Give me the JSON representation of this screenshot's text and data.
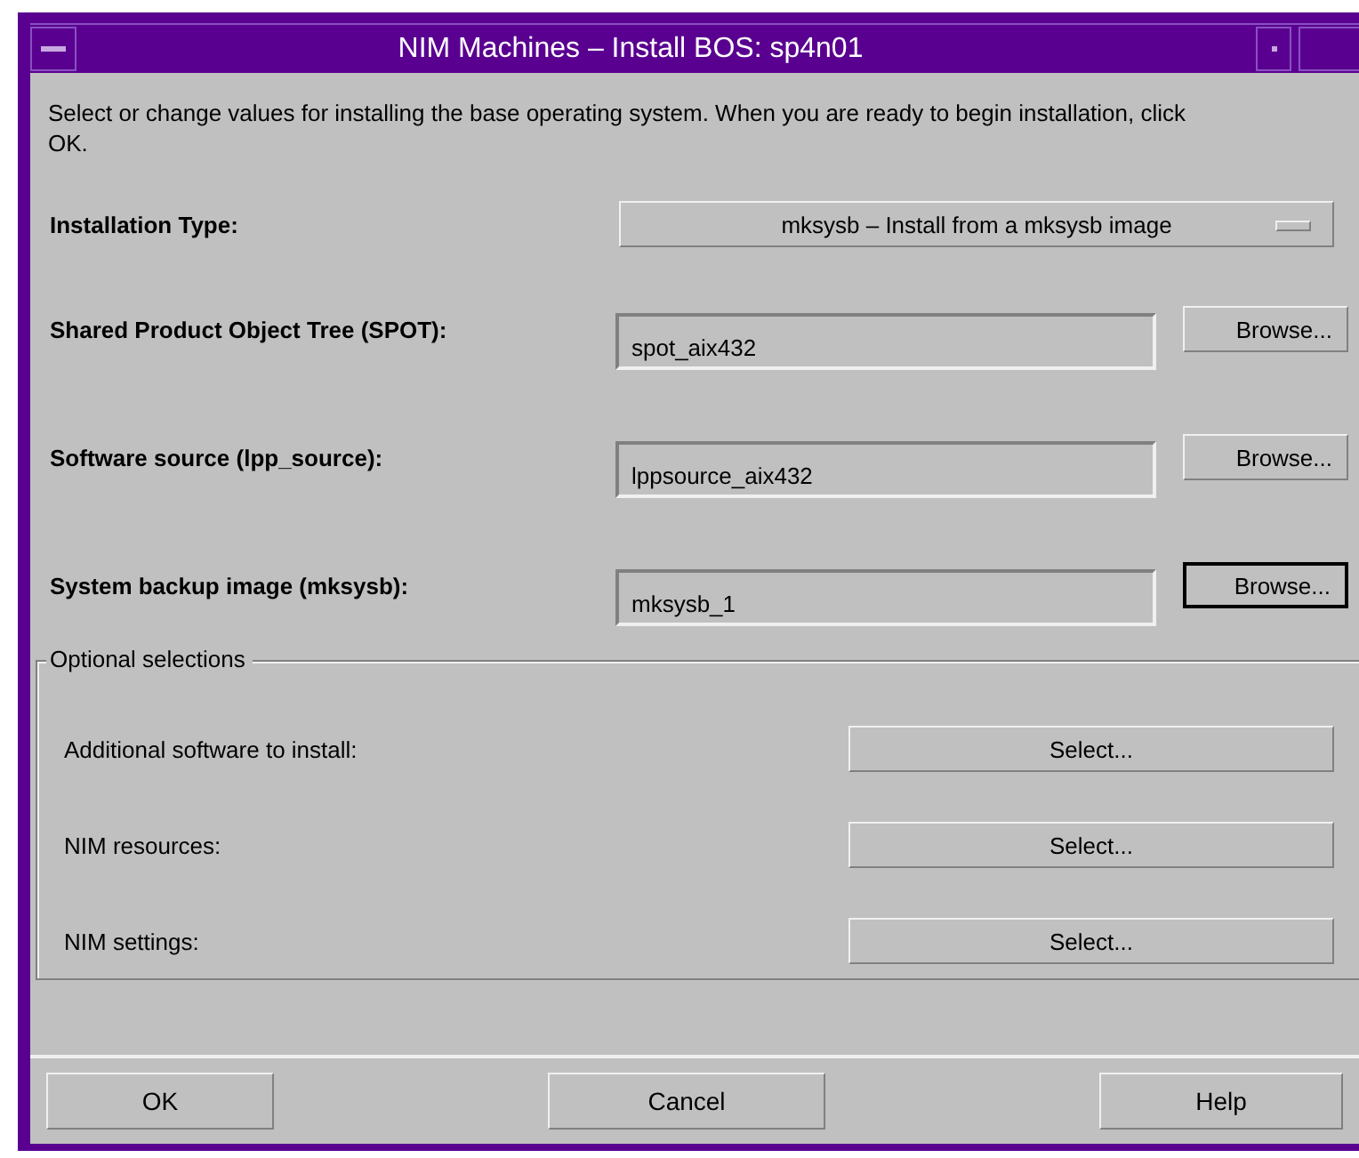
{
  "window": {
    "title": "NIM Machines – Install BOS: sp4n01"
  },
  "description": "Select or change values for installing the base operating system.  When you are ready to begin installation, click OK.",
  "installation_type": {
    "label": "Installation Type:",
    "value": "mksysb – Install from a mksysb image"
  },
  "fields": [
    {
      "label": "Shared Product Object Tree (SPOT):",
      "value": "spot_aix432",
      "button": "Browse...",
      "focused": false
    },
    {
      "label": "Software source (lpp_source):",
      "value": "lppsource_aix432",
      "button": "Browse...",
      "focused": false
    },
    {
      "label": "System backup image (mksysb):",
      "value": "mksysb_1",
      "button": "Browse...",
      "focused": true
    }
  ],
  "optional": {
    "title": "Optional selections",
    "rows": [
      {
        "label": "Additional software to install:",
        "button": "Select..."
      },
      {
        "label": "NIM resources:",
        "button": "Select..."
      },
      {
        "label": "NIM settings:",
        "button": "Select..."
      }
    ]
  },
  "buttons": [
    "OK",
    "Cancel",
    "Help"
  ]
}
